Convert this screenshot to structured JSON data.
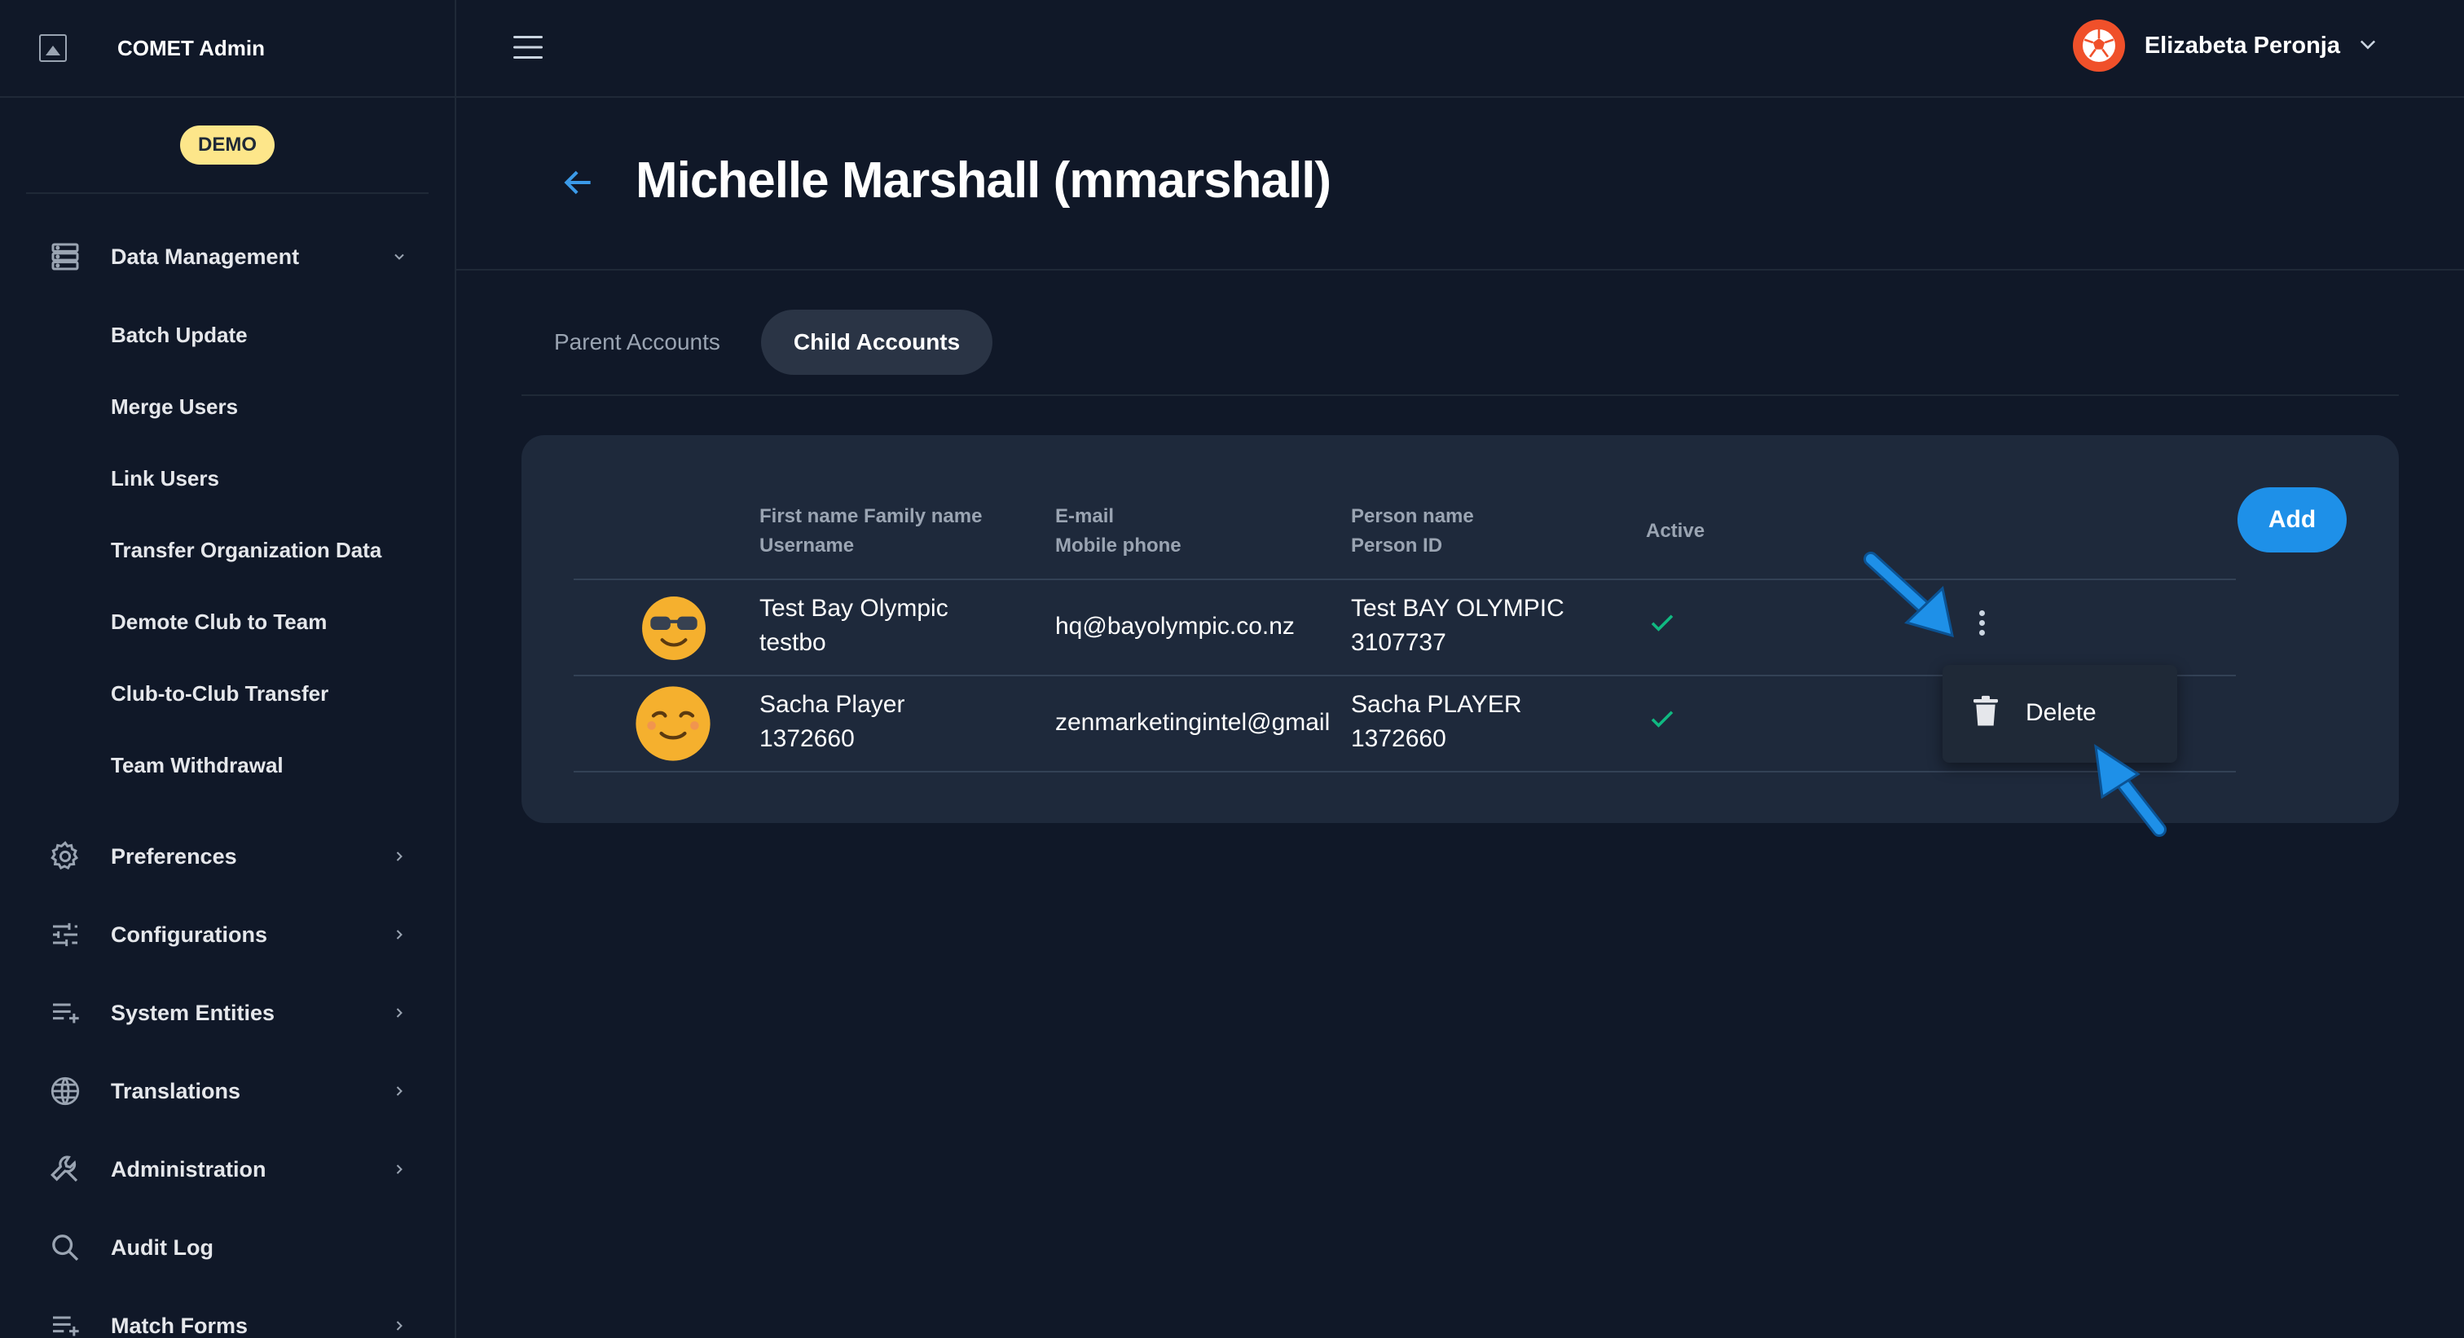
{
  "app": {
    "title": "COMET Admin",
    "env_badge": "DEMO"
  },
  "user": {
    "name": "Elizabeta Peronja"
  },
  "sidebar": {
    "sections": [
      {
        "label": "Data Management",
        "icon": "database-icon",
        "expanded": true
      },
      {
        "label": "Preferences",
        "icon": "gear-icon"
      },
      {
        "label": "Configurations",
        "icon": "sliders-icon"
      },
      {
        "label": "System Entities",
        "icon": "list-add-icon"
      },
      {
        "label": "Translations",
        "icon": "globe-icon"
      },
      {
        "label": "Administration",
        "icon": "wrench-icon"
      },
      {
        "label": "Audit Log",
        "icon": "search-icon"
      },
      {
        "label": "Match Forms",
        "icon": "list-add-icon"
      }
    ],
    "data_management_items": [
      "Batch Update",
      "Merge Users",
      "Link Users",
      "Transfer Organization Data",
      "Demote Club to Team",
      "Club-to-Club Transfer",
      "Team Withdrawal"
    ]
  },
  "page": {
    "title": "Michelle Marshall (mmarshall)"
  },
  "tabs": [
    {
      "label": "Parent Accounts",
      "active": false
    },
    {
      "label": "Child Accounts",
      "active": true
    }
  ],
  "table": {
    "add_label": "Add",
    "headers": {
      "name_line1": "First name Family name",
      "name_line2": "Username",
      "contact_line1": "E-mail",
      "contact_line2": "Mobile phone",
      "person_line1": "Person name",
      "person_line2": "Person ID",
      "active": "Active"
    },
    "rows": [
      {
        "avatar": "sunglasses-emoji-icon",
        "full_name": "Test Bay Olympic",
        "username": "testbo",
        "email": "hq@bayolympic.co.nz",
        "person_name": "Test BAY OLYMPIC",
        "person_id": "3107737",
        "active": true
      },
      {
        "avatar": "smiling-emoji-icon",
        "full_name": "Sacha Player",
        "username": "1372660",
        "email": "zenmarketingintel@gmail",
        "person_name": "Sacha PLAYER",
        "person_id": "1372660",
        "active": true
      }
    ]
  },
  "row_menu": {
    "items": [
      {
        "label": "Delete",
        "icon": "trash-icon"
      }
    ]
  },
  "colors": {
    "background": "#101828",
    "card": "#1e293b",
    "accent": "#1e90e8",
    "badge": "#fde68a",
    "check": "#10b981",
    "callout_arrow": "#1e90e8"
  }
}
